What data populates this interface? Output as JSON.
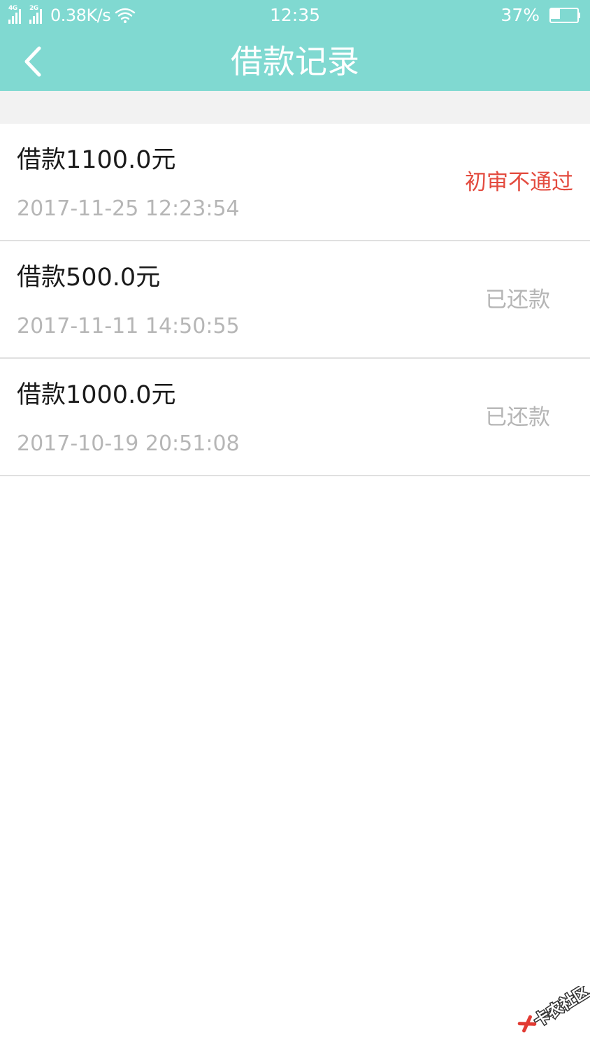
{
  "status_bar": {
    "network_1": "4G",
    "network_2": "2G",
    "speed": "0.38K/s",
    "time": "12:35",
    "battery": "37%",
    "battery_level": 0.37,
    "icons": [
      "signal-icon",
      "signal-icon",
      "wifi-icon",
      "battery-icon"
    ]
  },
  "nav": {
    "back_icon": "chevron-left-icon",
    "title": "借款记录"
  },
  "records": [
    {
      "amount": "借款1100.0元",
      "time": "2017-11-25 12:23:54",
      "status": "初审不通过"
    },
    {
      "amount": "借款500.0元",
      "time": "2017-11-11 14:50:55",
      "status": "已还款"
    },
    {
      "amount": "借款1000.0元",
      "time": "2017-10-19 20:51:08",
      "status": "已还款"
    }
  ],
  "colors": {
    "header": "#80d9d1",
    "status_rejected": "#e34b3f",
    "status_repaid": "#b5b5b5",
    "secondary_text": "#b6b6b6"
  },
  "watermark": {
    "text": "卡农社区"
  }
}
